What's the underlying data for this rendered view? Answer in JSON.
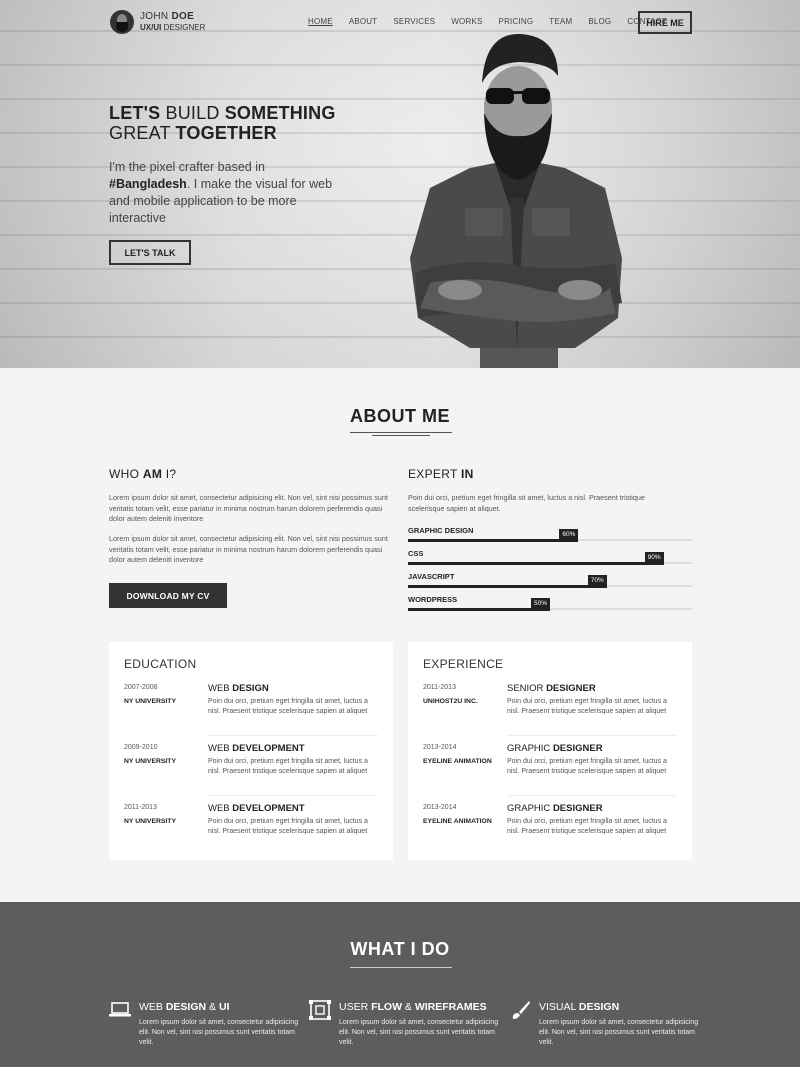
{
  "brand": {
    "name_light": "JOHN ",
    "name_bold": "DOE",
    "role_bold": "UX/UI",
    "role_light": " DESIGNER"
  },
  "nav": {
    "items": [
      "HOME",
      "ABOUT",
      "SERVICES",
      "WORKS",
      "PRICING",
      "TEAM",
      "BLOG",
      "CONTACT"
    ],
    "active": "HOME",
    "hire_label": "HIRE ME"
  },
  "hero": {
    "line1_bold1": "LET'S",
    "line1_light": " BUILD ",
    "line1_bold2": "SOMETHING",
    "line2_light": "GREAT ",
    "line2_bold": "TOGETHER",
    "desc_before": "I'm the pixel crafter based in ",
    "desc_bold": "#Bangladesh",
    "desc_after": ". I make the visual for web and mobile application to be more interactive",
    "cta_label": "LET'S TALK"
  },
  "about": {
    "title": "ABOUT ME",
    "who_light": "WHO ",
    "who_bold": "AM",
    "who_end": " I?",
    "para1": "Lorem ipsum dolor sit amet, consectetur adipisicing elit. Non vel, sint nisi possimus sunt veritatis totam velit, esse pariatur in minima nostrum harum dolorem perferendis quasi dolor autem deleniti inventore",
    "para2": "Lorem ipsum dolor sit amet, consectetur adipisicing elit. Non vel, sint nisi possimus sunt veritatis totam velit, esse pariatur in minima nostrum harum dolorem perferendis quasi dolor autem deleniti inventore",
    "cv_label": "DOWNLOAD MY CV",
    "expert_light": "EXPERT ",
    "expert_bold": "IN",
    "expert_desc": "Poin dui orci, pretium eget fringilla sit amet, luctus a nisl. Praesent tristique scelerisque sapien at aliquet.",
    "skills": [
      {
        "name": "GRAPHIC DESIGN",
        "label": "60%",
        "value": 0.6
      },
      {
        "name": "CSS",
        "label": "90%",
        "value": 0.9
      },
      {
        "name": "JAVASCRIPT",
        "label": "70%",
        "value": 0.7
      },
      {
        "name": "WORDPRESS",
        "label": "50%",
        "value": 0.5
      }
    ]
  },
  "education": {
    "title": "EDUCATION",
    "entries": [
      {
        "year": "2007-2008",
        "org": "NY UNIVERSITY",
        "title_light": "WEB ",
        "title_bold": "DESIGN",
        "desc": "Poin dui orci, pretium eget fringilla sit amet, luctus a nisl. Praesent tristique scelerisque sapien at aliquet"
      },
      {
        "year": "2009-2010",
        "org": "NY UNIVERSITY",
        "title_light": "WEB ",
        "title_bold": "DEVELOPMENT",
        "desc": "Poin dui orci, pretium eget fringilla sit amet, luctus a nisl. Praesent tristique scelerisque sapien at aliquet"
      },
      {
        "year": "2011-2013",
        "org": "NY UNIVERSITY",
        "title_light": "WEB ",
        "title_bold": "DEVELOPMENT",
        "desc": "Poin dui orci, pretium eget fringilla sit amet, luctus a nisl. Praesent tristique scelerisque sapien at aliquet"
      }
    ]
  },
  "experience": {
    "title": "EXPERIENCE",
    "entries": [
      {
        "year": "2011-2013",
        "org": "UNIHOST2U INC.",
        "title_light": "SENIOR ",
        "title_bold": "DESIGNER",
        "desc": "Poin dui orci, pretium eget fringilla sit amet, luctus a nisl. Praesent tristique scelerisque sapien at aliquet"
      },
      {
        "year": "2013-2014",
        "org": "EYELINE ANIMATION",
        "title_light": "GRAPHIC ",
        "title_bold": "DESIGNER",
        "desc": "Poin dui orci, pretium eget fringilla sit amet, luctus a nisl. Praesent tristique scelerisque sapien at aliquet"
      },
      {
        "year": "2013-2014",
        "org": "EYELINE ANIMATION",
        "title_light": "GRAPHIC ",
        "title_bold": "DESIGNER",
        "desc": "Poin dui orci, pretium eget fringilla sit amet, luctus a nisl. Praesent tristique scelerisque sapien at aliquet"
      }
    ]
  },
  "whatido": {
    "title": "WHAT I DO",
    "services": [
      {
        "icon": "laptop-icon",
        "title_light": "WEB ",
        "title_bold": "DESIGN",
        "title_mid": " & ",
        "title_bold2": "UI",
        "desc": "Lorem ipsum dolor sit amet, consectetur adipisicing elit. Non vel, sint nisi possimus sunt veritatis totam velit."
      },
      {
        "icon": "wireframe-icon",
        "title_light": "USER ",
        "title_bold": "FLOW",
        "title_mid": " & ",
        "title_bold2": "WIREFRAMES",
        "desc": "Lorem ipsum dolor sit amet, consectetur adipisicing elit. Non vel, sint nisi possimus sunt veritatis totam velit."
      },
      {
        "icon": "brush-icon",
        "title_light": "VISUAL ",
        "title_bold": "DESIGN",
        "title_mid": "",
        "title_bold2": "",
        "desc": "Lorem ipsum dolor sit amet, consectetur adipisicing elit. Non vel, sint nisi possimus sunt veritatis totam velit."
      }
    ]
  },
  "colors": {
    "dark": "#333333",
    "section_bg": "#f4f4f4",
    "services_bg": "#5d5d5d"
  }
}
